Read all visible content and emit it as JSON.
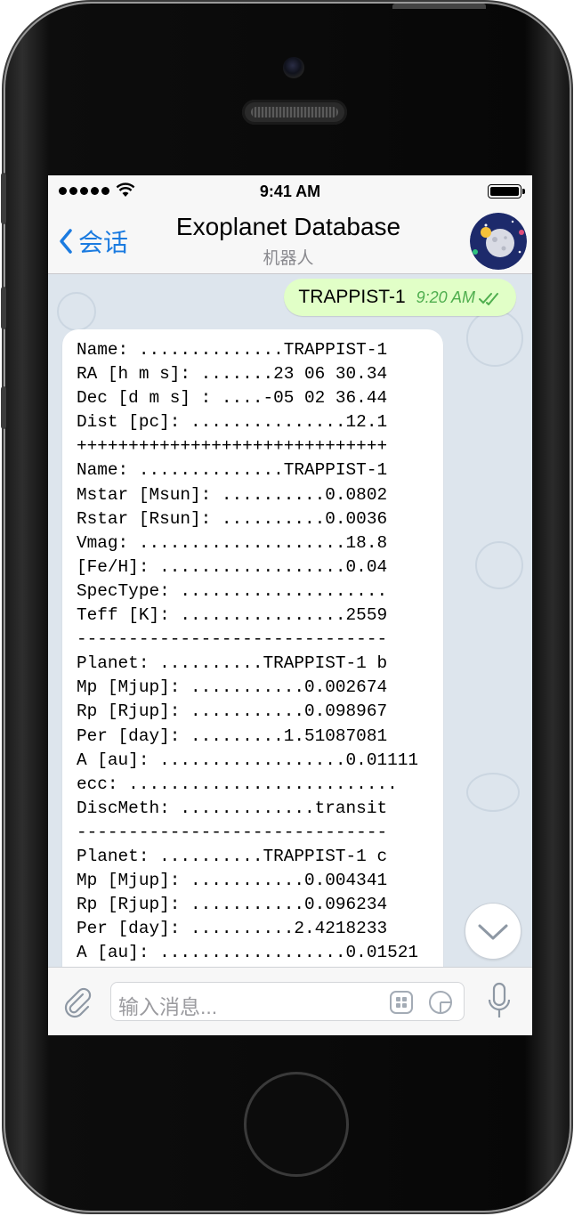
{
  "status_bar": {
    "time": "9:41 AM"
  },
  "header": {
    "back_label": "会话",
    "title": "Exoplanet Database",
    "subtitle": "机器人"
  },
  "messages": {
    "outgoing": {
      "text": "TRAPPIST-1",
      "time": "9:20 AM"
    },
    "incoming": {
      "lines": [
        "Name: ..............TRAPPIST-1",
        "RA [h m s]: .......23 06 30.34",
        "Dec [d m s] : ....-05 02 36.44",
        "Dist [pc]: ...............12.1",
        "++++++++++++++++++++++++++++++",
        "Name: ..............TRAPPIST-1",
        "Mstar [Msun]: ..........0.0802",
        "Rstar [Rsun]: ..........0.0036",
        "Vmag: ....................18.8",
        "[Fe/H]: ..................0.04",
        "SpecType: ....................",
        "Teff [K]: ................2559",
        "------------------------------",
        "Planet: ..........TRAPPIST-1 b",
        "Mp [Mjup]: ...........0.002674",
        "Rp [Rjup]: ...........0.098967",
        "Per [day]: .........1.51087081",
        "A [au]: ..................0.01111",
        "ecc: ..........................",
        "DiscMeth: .............transit",
        "------------------------------",
        "Planet: ..........TRAPPIST-1 c",
        "Mp [Mjup]: ...........0.004341",
        "Rp [Rjup]: ...........0.096234",
        "Per [day]: ..........2.4218233",
        "A [au]: ..................0.01521"
      ]
    }
  },
  "input_bar": {
    "placeholder": "输入消息..."
  },
  "colors": {
    "accent": "#1b7be0",
    "outgoing_bubble": "#e1ffc7",
    "outgoing_meta": "#4fae4e",
    "chat_background": "#dde5ed"
  }
}
